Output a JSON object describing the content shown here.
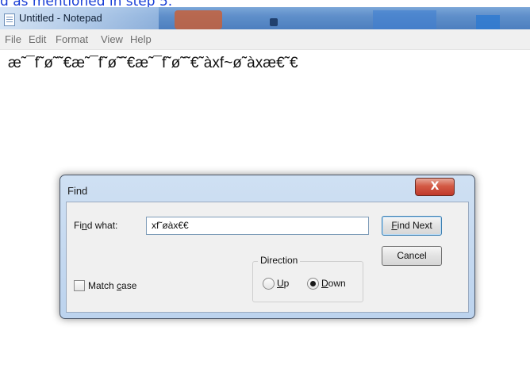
{
  "caption": "d as mentioned in step 5.",
  "window": {
    "title": "Untitled - Notepad"
  },
  "menu": [
    "File",
    "Edit",
    "Format",
    "View",
    "Help"
  ],
  "editor": {
    "content": "æ˜¯f˜ø˜˜€æ˜¯f˜ø˜˜€æ˜¯f˜ø˜˜€˜àxf~ø˜àxæ€˜€"
  },
  "find_dialog": {
    "title": "Find",
    "close_label": "X",
    "find_what_label_pre": "Fi",
    "find_what_label_u": "n",
    "find_what_label_post": "d what:",
    "find_what_value": "xf˜øàx€€",
    "find_next_pre": "",
    "find_next_u": "F",
    "find_next_post": "ind Next",
    "cancel_label": "Cancel",
    "direction_label": "Direction",
    "up_u": "U",
    "up_post": "p",
    "down_u": "D",
    "down_post": "own",
    "match_case_pre": "Match ",
    "match_case_u": "c",
    "match_case_post": "ase",
    "direction_selected": "Down",
    "match_case_checked": false
  }
}
